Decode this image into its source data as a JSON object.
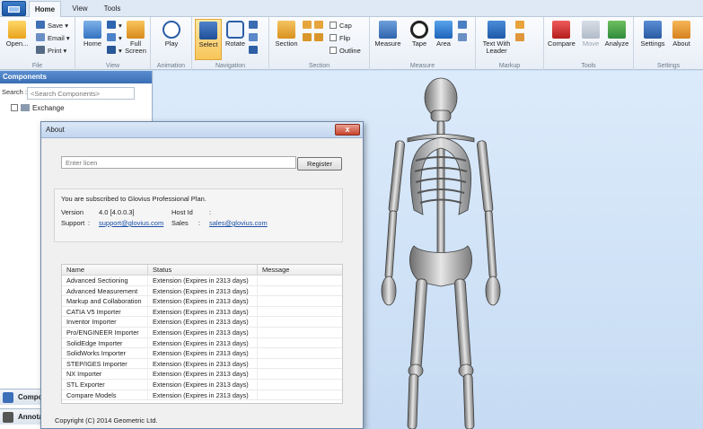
{
  "tabs": [
    "Home",
    "View",
    "Tools"
  ],
  "ribbon": {
    "file": {
      "open": "Open...",
      "save": "Save",
      "email": "Email",
      "print": "Print",
      "label": "File"
    },
    "view": {
      "home": "Home",
      "fullscreen": "Full Screen",
      "label": "View"
    },
    "animation": {
      "play": "Play",
      "label": "Animation"
    },
    "navigation": {
      "select": "Select",
      "rotate": "Rotate",
      "label": "Navigation"
    },
    "section": {
      "section": "Section",
      "cap": "Cap",
      "flip": "Flip",
      "outline": "Outline",
      "label": "Section"
    },
    "measure": {
      "measure": "Measure",
      "tape": "Tape",
      "area": "Area",
      "label": "Measure"
    },
    "markup": {
      "text_with_leader": "Text With Leader",
      "label": "Markup"
    },
    "tools": {
      "compare": "Compare",
      "move": "Move",
      "analyze": "Analyze",
      "label": "Tools"
    },
    "settings": {
      "settings": "Settings",
      "about": "About",
      "label": "Settings"
    }
  },
  "components_panel": {
    "title": "Components",
    "search_label": "Search :",
    "search_placeholder": "<Search Components>",
    "tree_root": "Exchange",
    "bottom_tab_1": "Compo",
    "bottom_tab_2": "Annota"
  },
  "about_dialog": {
    "title": "About",
    "close": "x",
    "license_placeholder": "Enter licen",
    "register": "Register",
    "subscription": "You are subscribed to Glovius Professional Plan.",
    "version_label": "Version",
    "version_value": "4.0 [4.0.0.3]",
    "host_id_label": "Host Id",
    "host_id_value": ":",
    "support_label": "Support",
    "support_value": "support@glovius.com",
    "sales_label": "Sales",
    "sales_value": "sales@glovius.com",
    "columns": [
      "Name",
      "Status",
      "Message"
    ],
    "extensions": [
      {
        "name": "Advanced Sectioning",
        "status": "Extension (Expires in 2313 days)"
      },
      {
        "name": "Advanced Measurement",
        "status": "Extension (Expires in 2313 days)"
      },
      {
        "name": "Markup and Collaboration",
        "status": "Extension (Expires in 2313 days)"
      },
      {
        "name": "CATIA V5 Importer",
        "status": "Extension (Expires in 2313 days)"
      },
      {
        "name": "Inventor Importer",
        "status": "Extension (Expires in 2313 days)"
      },
      {
        "name": "Pro/ENGINEER Importer",
        "status": "Extension (Expires in 2313 days)"
      },
      {
        "name": "SolidEdge Importer",
        "status": "Extension (Expires in 2313 days)"
      },
      {
        "name": "SolidWorks Importer",
        "status": "Extension (Expires in 2313 days)"
      },
      {
        "name": "STEP/IGES Importer",
        "status": "Extension (Expires in 2313 days)"
      },
      {
        "name": "NX Importer",
        "status": "Extension (Expires in 2313 days)"
      },
      {
        "name": "STL Exporter",
        "status": "Extension (Expires in 2313 days)"
      },
      {
        "name": "Compare Models",
        "status": "Extension (Expires in 2313 days)"
      }
    ],
    "copyright": "Copyright (C) 2014 Geometric Ltd."
  }
}
